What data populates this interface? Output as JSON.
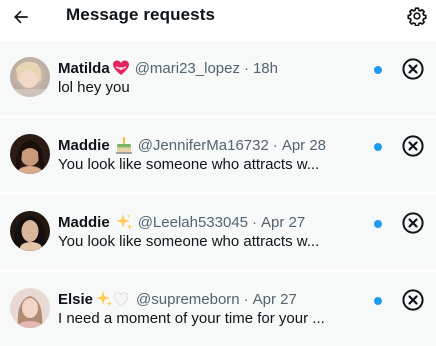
{
  "header": {
    "back_icon": "arrow-left-icon",
    "title": "Message requests",
    "settings_icon": "gear-icon"
  },
  "accent_color": "#1d9bf0",
  "requests": [
    {
      "name": "Matilda",
      "emoji_icon": "heart-with-ribbon-icon",
      "handle": "@mari23_lopez",
      "separator": "·",
      "time": "18h",
      "preview": "lol hey you",
      "unread": true
    },
    {
      "name": "Maddie",
      "emoji_icon": "cake-icon",
      "handle": "@JenniferMa16732",
      "separator": "·",
      "time": "Apr 28",
      "preview": "You look like someone who attracts w...",
      "unread": true
    },
    {
      "name": "Maddie",
      "emoji_icon": "sparkles-icon",
      "handle": "@Leelah533045",
      "separator": "·",
      "time": "Apr 27",
      "preview": "You look like someone who attracts w...",
      "unread": true
    },
    {
      "name": "Elsie",
      "emoji_icon": "sparkles-white-heart-icon",
      "handle": "@supremeborn",
      "separator": "·",
      "time": "Apr 27",
      "preview": "I need a moment of your time for your ...",
      "unread": true
    }
  ]
}
